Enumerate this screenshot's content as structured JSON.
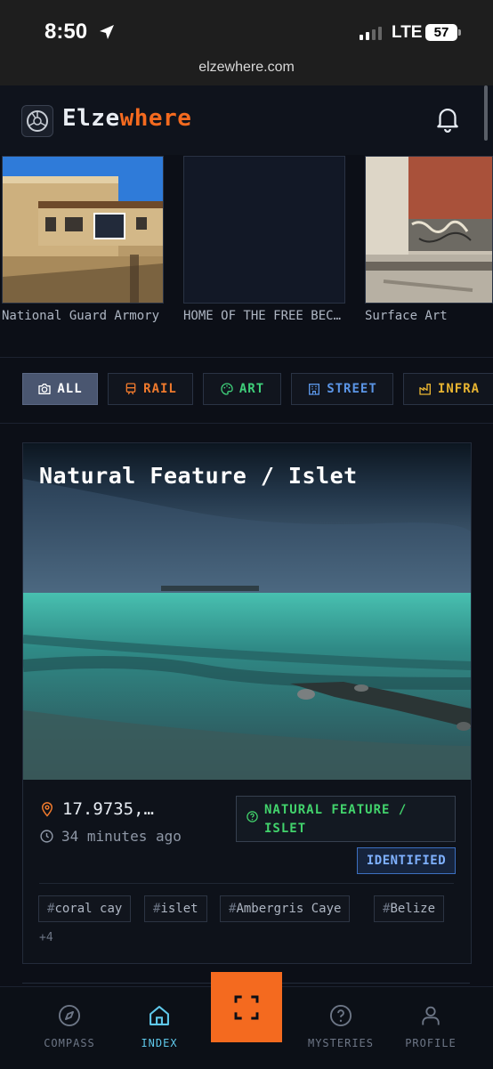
{
  "status": {
    "time": "8:50",
    "network": "LTE",
    "battery": "57"
  },
  "browser": {
    "url": "elzewhere.com"
  },
  "header": {
    "brand_part1": "Elze",
    "brand_part2": "where",
    "colors": {
      "accent": "#f46a1f"
    }
  },
  "carousel": {
    "items": [
      {
        "label": "National Guard Armory"
      },
      {
        "label": "HOME OF THE FREE BEC…"
      },
      {
        "label": "Surface Art"
      }
    ]
  },
  "filters": {
    "chips": [
      {
        "label": "ALL",
        "icon": "camera-icon",
        "color": "#ffffff",
        "active": true
      },
      {
        "label": "RAIL",
        "icon": "train-icon",
        "color": "#f07a2d"
      },
      {
        "label": "ART",
        "icon": "palette-icon",
        "color": "#3fcf7a"
      },
      {
        "label": "STREET",
        "icon": "building-icon",
        "color": "#5b95e6"
      },
      {
        "label": "INFRA",
        "icon": "factory-icon",
        "color": "#e8b431"
      }
    ]
  },
  "card": {
    "title": "Natural Feature / Islet",
    "coords": "17.9735,…",
    "time_ago": "34 minutes ago",
    "category": "NATURAL FEATURE / ISLET",
    "status": "IDENTIFIED",
    "tags": [
      "coral cay",
      "islet",
      "Ambergris Caye",
      "Belize"
    ],
    "tag_hash": "#",
    "more_tags": "+4"
  },
  "nav": {
    "items": [
      {
        "label": "COMPASS",
        "icon": "compass-icon"
      },
      {
        "label": "INDEX",
        "icon": "home-icon",
        "active": true
      },
      {
        "label": "MYSTERIES",
        "icon": "question-icon"
      },
      {
        "label": "PROFILE",
        "icon": "user-icon"
      }
    ],
    "scan_icon": "scan-icon"
  }
}
